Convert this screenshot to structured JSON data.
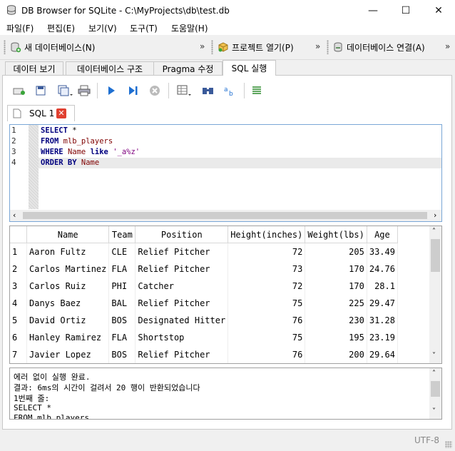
{
  "window": {
    "title": "DB Browser for SQLite - C:\\MyProjects\\db\\test.db",
    "minimize": "—",
    "maximize": "☐",
    "close": "✕"
  },
  "menu": [
    "파일(F)",
    "편집(E)",
    "보기(V)",
    "도구(T)",
    "도움말(H)"
  ],
  "toolbar": {
    "new_db": "새 데이터베이스(N)",
    "open_project": "프로젝트 열기(P)",
    "connect_db": "데이터베이스 연결(A)",
    "overflow": "»"
  },
  "tabs": [
    "데이터 보기",
    "데이터베이스 구조",
    "Pragma 수정",
    "SQL 실행"
  ],
  "active_tab": "SQL 실행",
  "sql_tab": {
    "label": "SQL 1"
  },
  "editor": {
    "line_numbers": [
      "1",
      "2",
      "3",
      "4"
    ],
    "lines": [
      [
        {
          "t": "SELECT",
          "c": "kw"
        },
        {
          "t": " *",
          "c": ""
        }
      ],
      [
        {
          "t": "FROM",
          "c": "kw"
        },
        {
          "t": " ",
          "c": ""
        },
        {
          "t": "mlb_players",
          "c": "id"
        }
      ],
      [
        {
          "t": "WHERE",
          "c": "kw"
        },
        {
          "t": " ",
          "c": ""
        },
        {
          "t": "Name",
          "c": "id"
        },
        {
          "t": " ",
          "c": ""
        },
        {
          "t": "like",
          "c": "kw"
        },
        {
          "t": " ",
          "c": ""
        },
        {
          "t": "'_a%z'",
          "c": "str"
        }
      ],
      [
        {
          "t": "ORDER BY",
          "c": "kw"
        },
        {
          "t": " ",
          "c": ""
        },
        {
          "t": "Name",
          "c": "id"
        }
      ]
    ]
  },
  "results": {
    "columns": [
      "",
      "Name",
      "Team",
      "Position",
      "Height(inches)",
      "Weight(lbs)",
      "Age"
    ],
    "rows": [
      [
        "1",
        "Aaron Fultz",
        "CLE",
        "Relief Pitcher",
        "72",
        "205",
        "33.49"
      ],
      [
        "2",
        "Carlos Martinez",
        "FLA",
        "Relief Pitcher",
        "73",
        "170",
        "24.76"
      ],
      [
        "3",
        "Carlos Ruiz",
        "PHI",
        "Catcher",
        "72",
        "170",
        "28.1"
      ],
      [
        "4",
        "Danys Baez",
        "BAL",
        "Relief Pitcher",
        "75",
        "225",
        "29.47"
      ],
      [
        "5",
        "David Ortiz",
        "BOS",
        "Designated Hitter",
        "76",
        "230",
        "31.28"
      ],
      [
        "6",
        "Hanley Ramirez",
        "FLA",
        "Shortstop",
        "75",
        "195",
        "23.19"
      ],
      [
        "7",
        "Javier Lopez",
        "BOS",
        "Relief Pitcher",
        "76",
        "200",
        "29.64"
      ]
    ]
  },
  "message": {
    "lines": [
      "에러 없이 실행 완료.",
      "결과: 6ms의 시간이 걸려서 20 행이 반환되었습니다",
      "1번째 줄:",
      "SELECT *",
      "FROM mlb_players"
    ]
  },
  "status": {
    "encoding": "UTF-8"
  },
  "colors": {
    "accent": "#1e6fd1",
    "keyword": "#00007f",
    "identifier": "#7f0000",
    "string": "#7f007f",
    "close_tab": "#e04030"
  }
}
